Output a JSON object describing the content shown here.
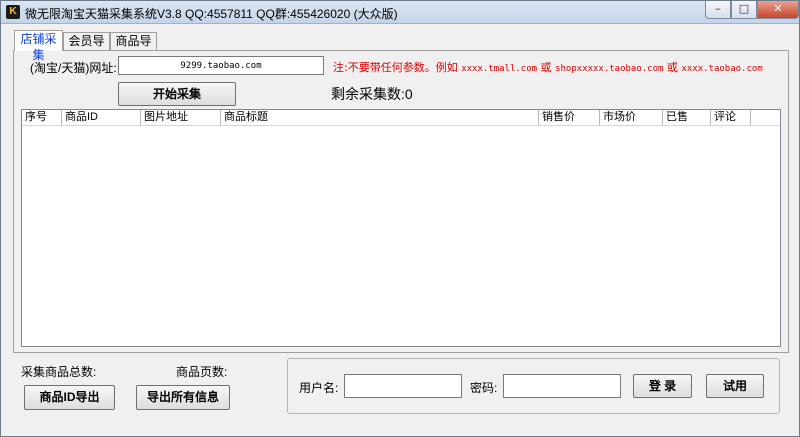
{
  "window": {
    "title": "微无限淘宝天猫采集系统V3.8 QQ:4557811 QQ群:455426020 (大众版)",
    "icon_text": "K",
    "min_symbol": "–",
    "max_symbol": "□",
    "close_symbol": "✕"
  },
  "tabs": [
    {
      "label": "店铺采集",
      "active": true
    },
    {
      "label": "会员导入",
      "active": false
    },
    {
      "label": "商品导入",
      "active": false
    }
  ],
  "shop": {
    "url_label": "(淘宝/天猫)网址:",
    "url_value": "9299.taobao.com",
    "note_prefix": "注:不要带任何参数。例如 ",
    "note_ex1": "xxxx.tmall.com",
    "note_or1": " 或 ",
    "note_ex2": "shopxxxxx.taobao.com",
    "note_or2": " 或 ",
    "note_ex3": "xxxx.taobao.com",
    "start_button": "开始采集",
    "remaining": "剩余采集数:0"
  },
  "table": {
    "columns": [
      "序号",
      "商品ID",
      "图片地址",
      "商品标题",
      "销售价",
      "市场价",
      "已售",
      "评论"
    ],
    "rows": []
  },
  "footer": {
    "total_label": "采集商品总数:",
    "pages_label": "商品页数:",
    "export_ids_button": "商品ID导出",
    "export_all_button": "导出所有信息"
  },
  "login": {
    "username_label": "用户名:",
    "username_value": "",
    "password_label": "密码:",
    "password_value": "",
    "login_button": "登 录",
    "trial_button": "试用"
  },
  "colors": {
    "note_red": "#e00000",
    "active_tab_text": "#0b3fd8",
    "window_bg": "#f0f0f0"
  }
}
